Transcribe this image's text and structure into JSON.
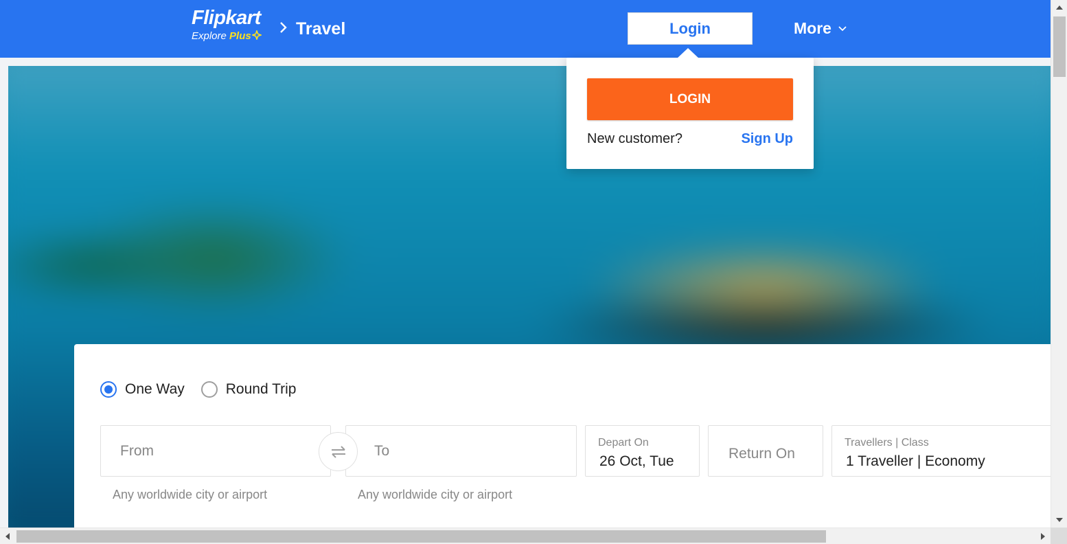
{
  "header": {
    "brand": "Flipkart",
    "tagline_prefix": "Explore ",
    "tagline_plus": "Plus",
    "breadcrumb": "Travel",
    "login_label": "Login",
    "more_label": "More"
  },
  "login_dropdown": {
    "login_button": "LOGIN",
    "new_customer": "New customer?",
    "signup_link": "Sign Up"
  },
  "search": {
    "trip_types": [
      {
        "label": "One Way",
        "checked": true
      },
      {
        "label": "Round Trip",
        "checked": false
      }
    ],
    "from_placeholder": "From",
    "to_placeholder": "To",
    "from_hint": "Any worldwide city or airport",
    "to_hint": "Any worldwide city or airport",
    "depart_label": "Depart On",
    "depart_value": "26 Oct, Tue",
    "return_placeholder": "Return On",
    "travellers_label": "Travellers | Class",
    "travellers_value": "1 Traveller | Economy"
  },
  "colors": {
    "header_bg": "#2874f0",
    "login_button_bg": "#fb641b",
    "plus_yellow": "#ffe11b",
    "link_blue": "#2874f0"
  },
  "icons": {
    "breadcrumb_arrow": "chevron-right-icon",
    "more_arrow": "chevron-down-icon",
    "swap": "swap-arrows-icon",
    "plus_mark": "plus-sparkle-icon"
  }
}
